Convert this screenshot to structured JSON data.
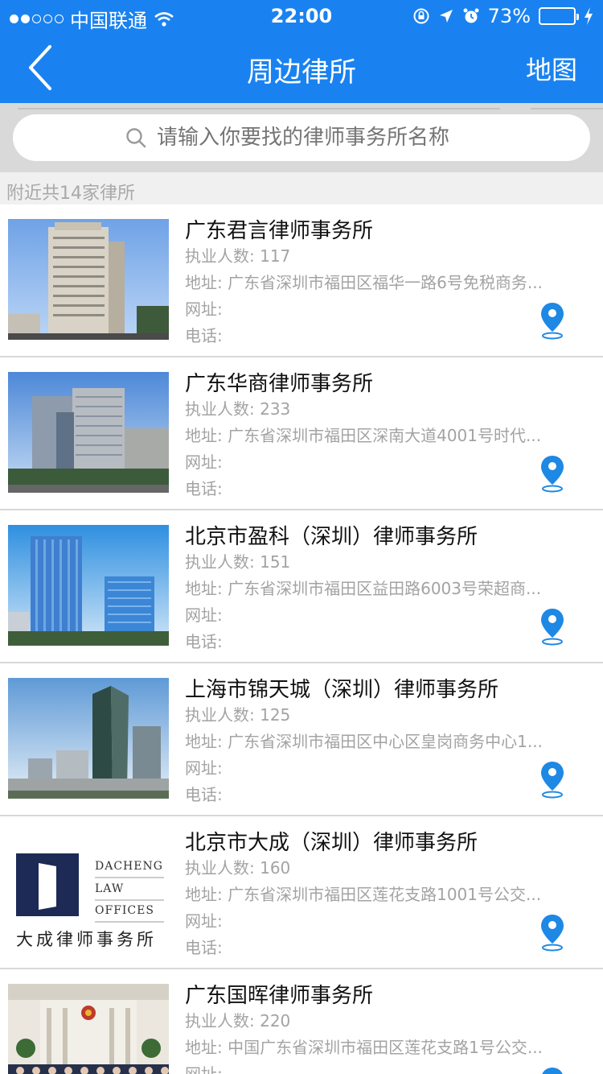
{
  "status_bar": {
    "carrier": "中国联通",
    "time": "22:00",
    "battery": "73%",
    "battery_level": 0.73
  },
  "nav": {
    "title": "周边律所",
    "map_label": "地图"
  },
  "search": {
    "placeholder": "请输入你要找的律师事务所名称"
  },
  "count_text": "附近共14家律所",
  "labels": {
    "staff": "执业人数: ",
    "address": "地址: ",
    "website": "网址:",
    "phone": "电话:"
  },
  "colors": {
    "primary": "#1a82f0",
    "pin": "#1e88e5"
  },
  "firms": [
    {
      "name": "广东君言律师事务所",
      "staff": "117",
      "address": "广东省深圳市福田区福华一路6号免税商务...",
      "image": "office-tower-photo"
    },
    {
      "name": "广东华商律师事务所",
      "staff": "233",
      "address": "广东省深圳市福田区深南大道4001号时代...",
      "image": "office-tower-photo"
    },
    {
      "name": "北京市盈科（深圳）律师事务所",
      "staff": "151",
      "address": "广东省深圳市福田区益田路6003号荣超商...",
      "image": "glass-towers-photo"
    },
    {
      "name": "上海市锦天城（深圳）律师事务所",
      "staff": "125",
      "address": "广东省深圳市福田区中心区皇岗商务中心1...",
      "image": "skyline-photo"
    },
    {
      "name": "北京市大成（深圳）律师事务所",
      "staff": "160",
      "address": "广东省深圳市福田区莲花支路1001号公交...",
      "image": "dacheng-logo",
      "logo": {
        "line1": "DACHENG",
        "line2": "LAW",
        "line3": "OFFICES",
        "cn": "大成律师事务所"
      }
    },
    {
      "name": "广东国晖律师事务所",
      "staff": "220",
      "address": "中国广东省深圳市福田区莲花支路1号公交...",
      "image": "group-photo"
    }
  ]
}
